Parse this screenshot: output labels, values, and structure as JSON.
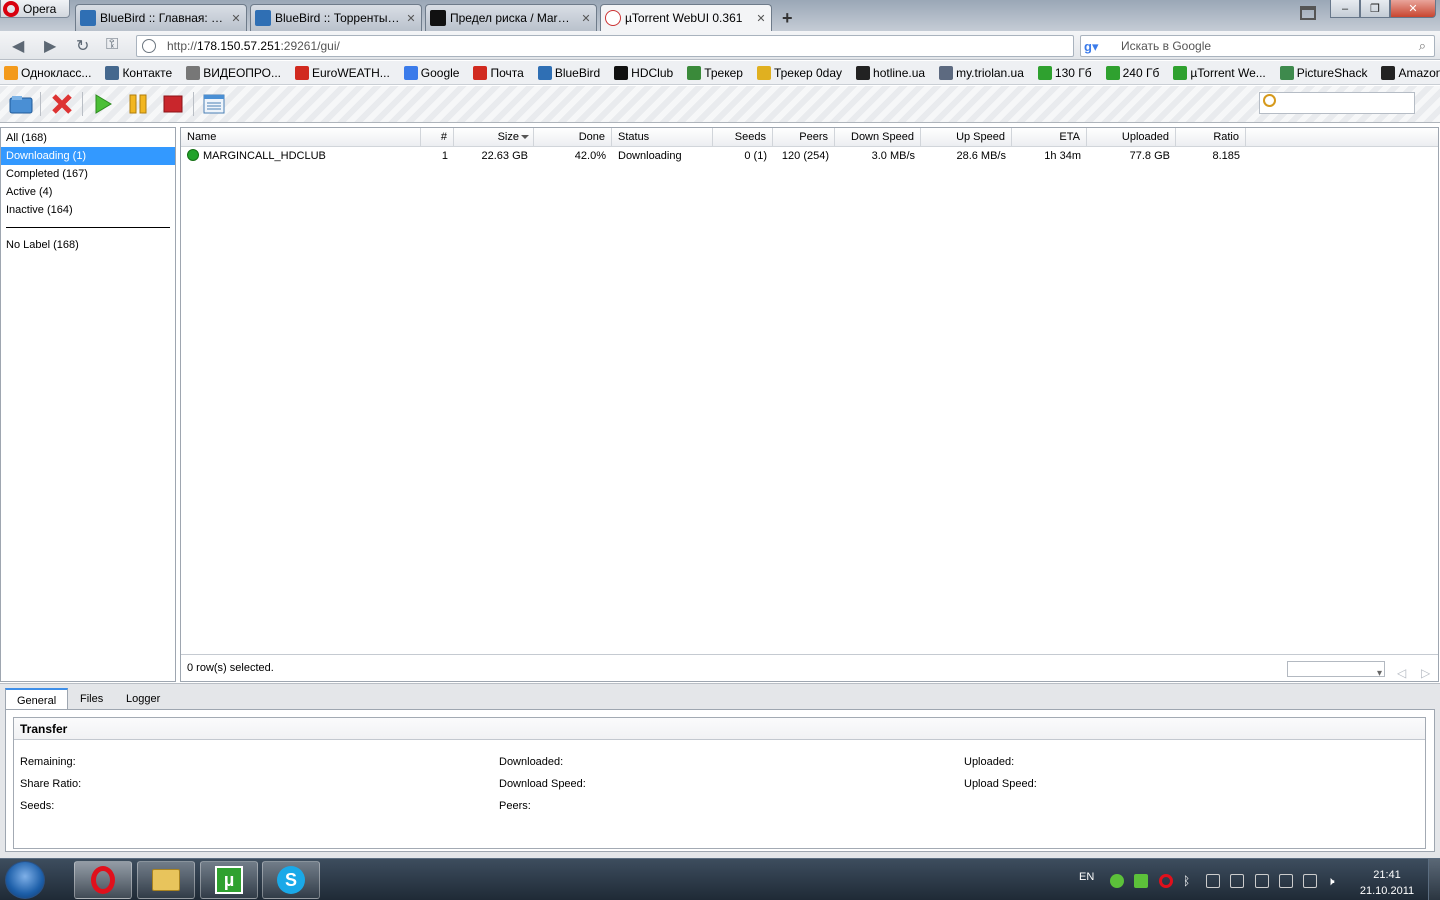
{
  "browser": {
    "menu_label": "Opera",
    "tabs": [
      {
        "title": "BlueBird :: Главная: ск...",
        "active": false
      },
      {
        "title": "BlueBird :: Торренты: с...",
        "active": false
      },
      {
        "title": "Предел риска / Margi...",
        "active": false
      },
      {
        "title": "µTorrent WebUI 0.361",
        "active": true
      }
    ],
    "url_prefix": "http://",
    "url_host": "178.150.57.251",
    "url_rest": ":29261/gui/",
    "search_placeholder": "Искать в Google",
    "bookmarks": [
      {
        "label": "Однокласс...",
        "color": "#f39a1c"
      },
      {
        "label": "Контакте",
        "color": "#45688e"
      },
      {
        "label": "ВИДЕОПРО...",
        "color": "#777777"
      },
      {
        "label": "EuroWEATH...",
        "color": "#d12a1f"
      },
      {
        "label": "Google",
        "color": "#3b7bea"
      },
      {
        "label": "Почта",
        "color": "#d12a1f"
      },
      {
        "label": "BlueBird",
        "color": "#2f6fb4"
      },
      {
        "label": "HDClub",
        "color": "#111111"
      },
      {
        "label": "Трекер",
        "color": "#3a8a3a"
      },
      {
        "label": "Трекер 0day",
        "color": "#e0b020"
      },
      {
        "label": "hotline.ua",
        "color": "#222222"
      },
      {
        "label": "my.triolan.ua",
        "color": "#5d6a80"
      },
      {
        "label": "130 Гб",
        "color": "#2fa12f"
      },
      {
        "label": "240 Гб",
        "color": "#2fa12f"
      },
      {
        "label": "µTorrent We...",
        "color": "#2fa12f"
      },
      {
        "label": "PictureShack",
        "color": "#3e8a4d"
      },
      {
        "label": "Amazon.co...",
        "color": "#222222"
      }
    ]
  },
  "toolbar": {
    "buttons": [
      "add-torrent",
      "remove",
      "start",
      "pause",
      "stop",
      "settings"
    ]
  },
  "categories": [
    {
      "label": "All (168)",
      "selected": false
    },
    {
      "label": "Downloading (1)",
      "selected": true
    },
    {
      "label": "Completed (167)",
      "selected": false
    },
    {
      "label": "Active (4)",
      "selected": false
    },
    {
      "label": "Inactive (164)",
      "selected": false
    }
  ],
  "labels": [
    {
      "label": "No Label (168)"
    }
  ],
  "table": {
    "columns": [
      "Name",
      "#",
      "Size",
      "Done",
      "Status",
      "Seeds",
      "Peers",
      "Down Speed",
      "Up Speed",
      "ETA",
      "Uploaded",
      "Ratio"
    ],
    "rows": [
      {
        "name": "MARGINCALL_HDCLUB",
        "num": "1",
        "size": "22.63 GB",
        "done": "42.0%",
        "status": "Downloading",
        "seeds": "0 (1)",
        "peers": "120 (254)",
        "down_speed": "3.0 MB/s",
        "up_speed": "28.6 MB/s",
        "eta": "1h 34m",
        "uploaded": "77.8 GB",
        "ratio": "8.185"
      }
    ],
    "selection_status": "0 row(s) selected."
  },
  "details": {
    "tabs": [
      "General",
      "Files",
      "Logger"
    ],
    "active_tab": "General",
    "section_title": "Transfer",
    "fields": {
      "remaining": "Remaining:",
      "share_ratio": "Share Ratio:",
      "seeds": "Seeds:",
      "downloaded": "Downloaded:",
      "download_speed": "Download Speed:",
      "peers": "Peers:",
      "uploaded": "Uploaded:",
      "upload_speed": "Upload Speed:"
    }
  },
  "taskbar": {
    "language": "EN",
    "time": "21:41",
    "date": "21.10.2011"
  }
}
